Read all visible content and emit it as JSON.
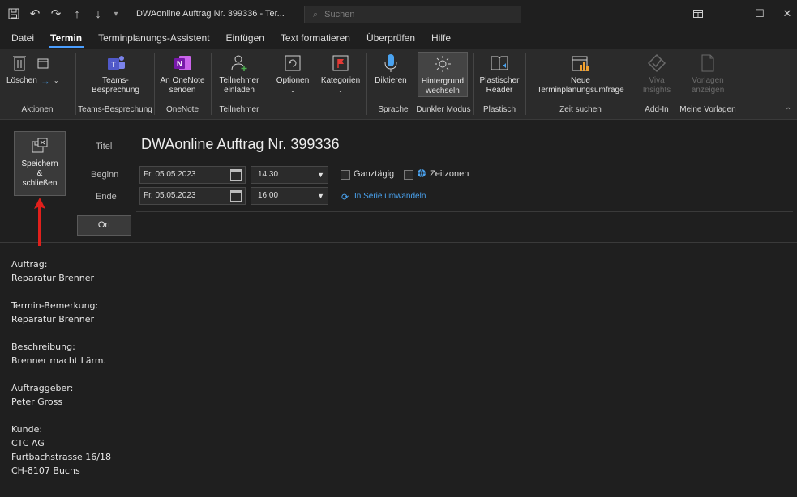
{
  "window": {
    "title": "DWAonline Auftrag Nr. 399336  -  Ter...",
    "search_placeholder": "Suchen"
  },
  "tabs": [
    {
      "label": "Datei"
    },
    {
      "label": "Termin",
      "active": true
    },
    {
      "label": "Terminplanungs-Assistent"
    },
    {
      "label": "Einfügen"
    },
    {
      "label": "Text formatieren"
    },
    {
      "label": "Überprüfen"
    },
    {
      "label": "Hilfe"
    }
  ],
  "ribbon": {
    "groups": {
      "aktionen": "Aktionen",
      "teams": "Teams-Besprechung",
      "onenote": "OneNote",
      "teilnehmer": "Teilnehmer",
      "sprache": "Sprache",
      "dunkler_modus": "Dunkler Modus",
      "plastisch": "Plastisch",
      "zeit_suchen": "Zeit suchen",
      "add_in": "Add-In",
      "meine_vorlagen": "Meine Vorlagen"
    },
    "buttons": {
      "loeschen": "Löschen",
      "teams_1": "Teams-",
      "teams_2": "Besprechung",
      "onenote_1": "An OneNote",
      "onenote_2": "senden",
      "teilnehmer_1": "Teilnehmer",
      "teilnehmer_2": "einladen",
      "optionen": "Optionen",
      "kategorien": "Kategorien",
      "diktieren": "Diktieren",
      "hintergrund_1": "Hintergrund",
      "hintergrund_2": "wechseln",
      "plastischer_1": "Plastischer",
      "plastischer_2": "Reader",
      "neue_1": "Neue",
      "neue_2": "Terminplanungsumfrage",
      "viva_1": "Viva",
      "viva_2": "Insights",
      "vorlagen_1": "Vorlagen",
      "vorlagen_2": "anzeigen"
    }
  },
  "form": {
    "save_1": "Speichern",
    "save_2": "&",
    "save_3": "schließen",
    "titel_label": "Titel",
    "titel_value": "DWAonline Auftrag Nr. 399336",
    "beginn_label": "Beginn",
    "beginn_date": "Fr. 05.05.2023",
    "beginn_time": "14:30",
    "ende_label": "Ende",
    "ende_date": "Fr. 05.05.2023",
    "ende_time": "16:00",
    "ganztaegig": "Ganztägig",
    "zeitzonen": "Zeitzonen",
    "serie": "In Serie umwandeln",
    "ort": "Ort",
    "accent_color": "#4aa3f0",
    "arrow_color": "#e0201c"
  },
  "notes": {
    "auftrag_label": "Auftrag:",
    "auftrag_value": "Reparatur Brenner",
    "bemerkung_label": "Termin-Bemerkung:",
    "bemerkung_value": "Reparatur Brenner",
    "beschreibung_label": "Beschreibung:",
    "beschreibung_value": "Brenner macht Lärm.",
    "auftraggeber_label": "Auftraggeber:",
    "auftraggeber_value": "Peter Gross",
    "kunde_label": "Kunde:",
    "kunde_name": "CTC AG",
    "kunde_strasse": "Furtbachstrasse 16/18",
    "kunde_ort": "CH-8107 Buchs"
  }
}
